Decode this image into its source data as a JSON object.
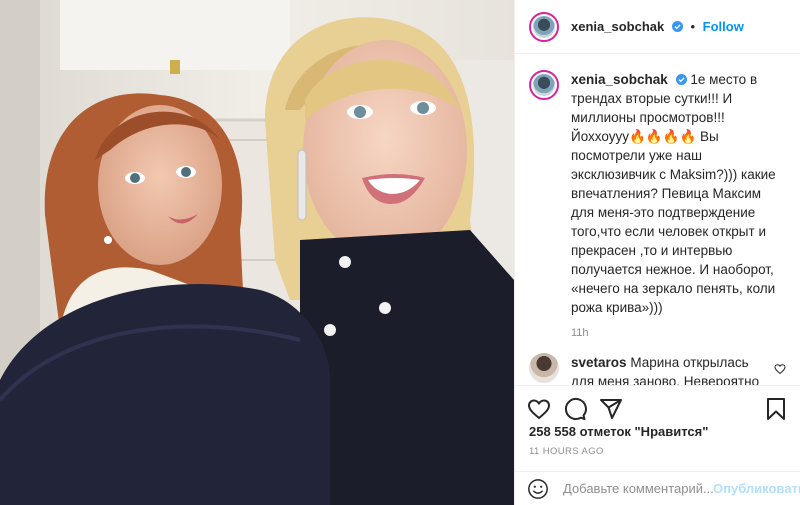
{
  "post": {
    "author": "xenia_sobchak",
    "follow_label": "Follow",
    "caption_author": "xenia_sobchak",
    "caption": "1е место в трендах вторые сутки!!! И миллионы просмотров!!! Йоххоууу🔥🔥🔥🔥 Вы посмотрели уже наш эксклюзивчик с Maksim?))) какие впечатления? Певица Максим для меня-это подтверждение того,что если человек открыт и прекрасен ,то и интервью получается нежное. И наоборот, «нечего на зеркало пенять, коли рожа крива»)))",
    "caption_time": "11h",
    "likes": "258 558 отметок \"Нравится\"",
    "time_ago": "11 HOURS AGO"
  },
  "comments": [
    {
      "author": "svetaros",
      "text": "Марина открылась для меня заново. Невероятно приятное интервью, честное, без пафоса и хайпа. Приятно было смотреть. Ксения, а Вы, как всегда, на высоте!🔥"
    }
  ],
  "composer": {
    "placeholder": "Добавьте комментарий...",
    "post_label": "Опубликовать"
  },
  "icons": {
    "like": "heart-icon",
    "comment": "comment-icon",
    "share": "share-icon",
    "save": "bookmark-icon",
    "emoji": "emoji-icon",
    "verified": "verified-badge-icon"
  },
  "colors": {
    "follow": "#0095f6",
    "verified": "#3897f0",
    "muted": "#8e8e8e",
    "post_disabled": "#b2dffc"
  }
}
